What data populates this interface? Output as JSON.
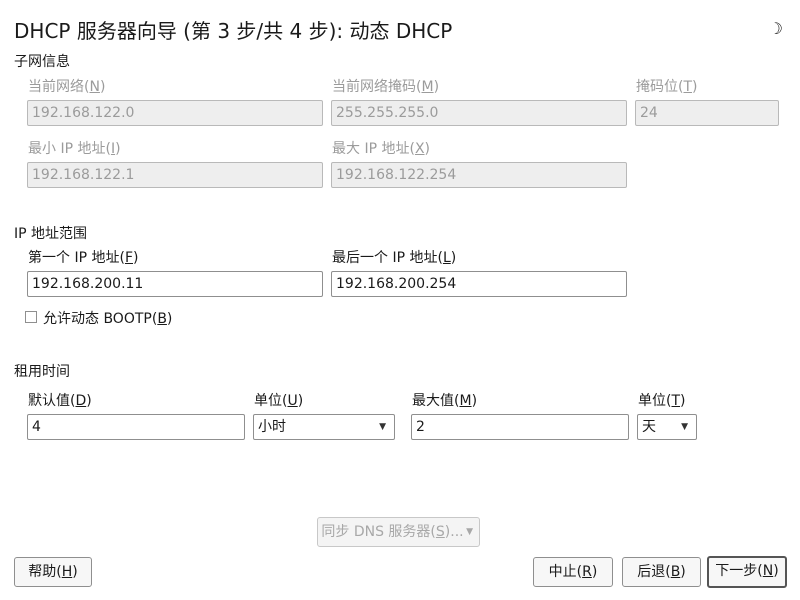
{
  "window": {
    "title": "DHCP 服务器向导 (第 3 步/共 4 步): 动态 DHCP",
    "theme_icon": "moon-icon"
  },
  "subnet": {
    "section": "子网信息",
    "network_label": "当前网络(N)",
    "network_value": "192.168.122.0",
    "netmask_label": "当前网络掩码(M)",
    "netmask_value": "255.255.255.0",
    "bits_label": "掩码位(T)",
    "bits_value": "24",
    "min_ip_label": "最小 IP 地址(I)",
    "min_ip_value": "192.168.122.1",
    "max_ip_label": "最大 IP 地址(X)",
    "max_ip_value": "192.168.122.254"
  },
  "range": {
    "section": "IP 地址范围",
    "first_label": "第一个 IP 地址(F)",
    "first_value": "192.168.200.11",
    "last_label": "最后一个 IP 地址(L)",
    "last_value": "192.168.200.254",
    "bootp_label": "允许动态 BOOTP(B)",
    "bootp_checked": false
  },
  "lease": {
    "section": "租用时间",
    "default_label": "默认值(D)",
    "default_value": "4",
    "unit1_label": "单位(U)",
    "unit1_value": "小时",
    "max_label": "最大值(M)",
    "max_value": "2",
    "unit2_label": "单位(T)",
    "unit2_value": "天"
  },
  "dns_sync_label": "同步 DNS 服务器(S)...",
  "buttons": {
    "help": "帮助(H)",
    "abort": "中止(R)",
    "back": "后退(B)",
    "next": "下一步(N)"
  }
}
